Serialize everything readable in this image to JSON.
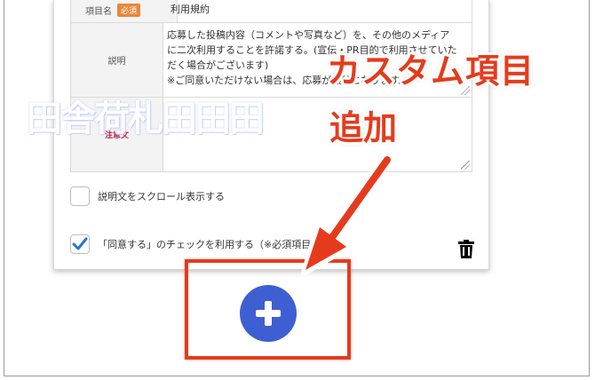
{
  "form": {
    "name_label": "項目名",
    "required_badge": "必須",
    "name_value": "利用規約",
    "description_label": "説明",
    "description_lines": [
      "応募した投稿内容（コメントや写真など）を、その他のメディア",
      "に二次利用することを許諾する。(宣伝・PR目的で利用させていた",
      "だく場合がございます)",
      "※ご同意いただけない場合は、応募が無効となります。"
    ],
    "note_label": "注意文",
    "note_value": "",
    "scroll_checkbox_label": "説明文をスクロール表示する",
    "scroll_checkbox_checked": false,
    "agree_checkbox_label": "「同意する」のチェックを利用する（※必須項目",
    "agree_checkbox_checked": true
  },
  "annotation": {
    "callout_line1": "カスタム項目",
    "callout_line2": "追加",
    "watermark_text": "田舎荷札田田田"
  },
  "colors": {
    "accent_red": "#e53b1d",
    "add_button_blue": "#3e5fd1",
    "badge_orange": "#e8883a",
    "checkbox_blue": "#2f6fdf"
  },
  "icons": {
    "add": "plus-circle-icon",
    "delete": "trash-icon",
    "check": "checkmark-icon",
    "resize": "resize-handle-icon"
  }
}
